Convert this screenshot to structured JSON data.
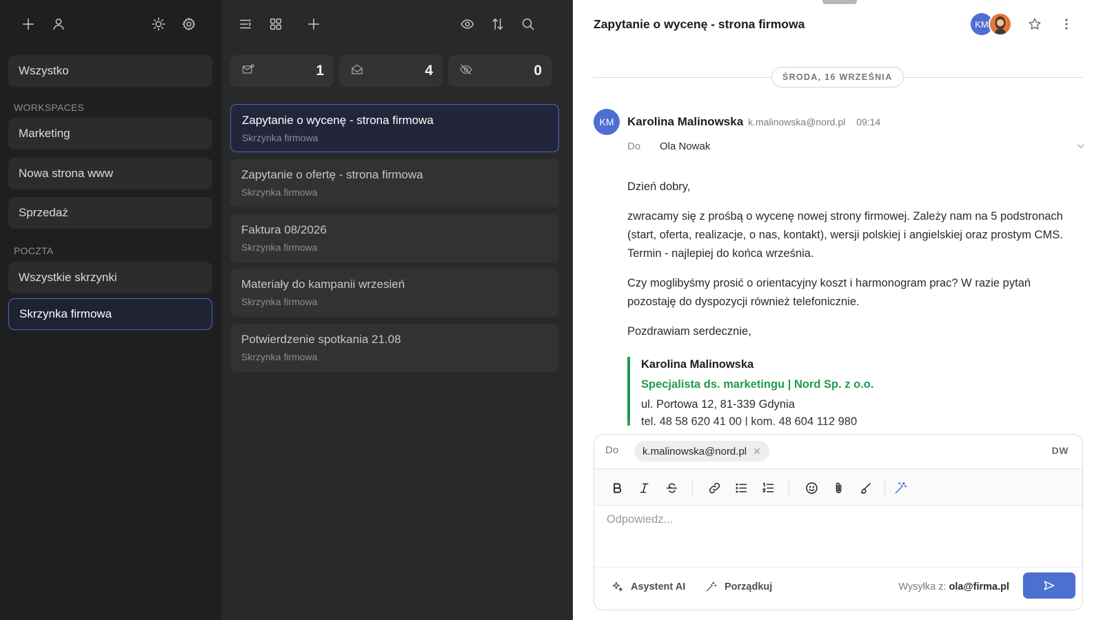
{
  "sidebar": {
    "top_icons": [
      "plus-icon",
      "user-icon",
      "sun-icon",
      "gear-icon"
    ],
    "all_label": "Wszystko",
    "workspaces_heading": "WORKSPACES",
    "workspaces": [
      {
        "label": "Marketing"
      },
      {
        "label": "Nowa strona www"
      },
      {
        "label": "Sprzedaż"
      }
    ],
    "mail_heading": "POCZTA",
    "mailboxes": [
      {
        "label": "Wszystkie skrzynki",
        "active": false
      },
      {
        "label": "Skrzynka firmowa",
        "active": true
      }
    ]
  },
  "list": {
    "top_icons": [
      "list-indent-icon",
      "grid-icon",
      "plus-icon",
      "eye-icon",
      "sort-icon",
      "search-icon"
    ],
    "counters": [
      {
        "icon": "unread-mail-icon",
        "value": "1"
      },
      {
        "icon": "open-mail-icon",
        "value": "4"
      },
      {
        "icon": "hidden-icon",
        "value": "0"
      }
    ],
    "items": [
      {
        "subject": "Zapytanie o wycenę - strona firmowa",
        "mailbox": "Skrzynka firmowa",
        "active": true
      },
      {
        "subject": "Zapytanie o ofertę - strona firmowa",
        "mailbox": "Skrzynka firmowa",
        "active": false
      },
      {
        "subject": "Faktura 08/2026",
        "mailbox": "Skrzynka firmowa",
        "active": false
      },
      {
        "subject": "Materiały do kampanii wrzesień",
        "mailbox": "Skrzynka firmowa",
        "active": false
      },
      {
        "subject": "Potwierdzenie spotkania 21.08",
        "mailbox": "Skrzynka firmowa",
        "active": false
      }
    ]
  },
  "reader": {
    "title": "Zapytanie o wycenę - strona firmowa",
    "participant_initials": "KM",
    "date_label": "ŚRODA, 16 WRZEŚNIA",
    "sender": {
      "initials": "KM",
      "name": "Karolina Malinowska",
      "email": "k.malinowska@nord.pl",
      "time": "09:14"
    },
    "to_label": "Do",
    "to_value": "Ola Nowak",
    "body": {
      "greeting": "Dzień dobry,",
      "p1": "zwracamy się z prośbą o wycenę nowej strony firmowej. Zależy nam na 5 podstronach (start, oferta, realizacje, o nas, kontakt), wersji polskiej i angielskiej oraz prostym CMS. Termin - najlepiej do końca września.",
      "p2": "Czy moglibyśmy prosić o orientacyjny koszt i harmonogram prac? W razie pytań pozostaję do dyspozycji również telefonicznie.",
      "closing": "Pozdrawiam serdecznie,"
    },
    "signature": {
      "name": "Karolina Malinowska",
      "role": "Specjalista ds. marketingu | Nord Sp. z o.o.",
      "address": "ul. Portowa 12, 81-339 Gdynia",
      "phone": "tel. 48 58 620 41 00 | kom. 48 604 112 980"
    }
  },
  "composer": {
    "to_label": "Do",
    "recipient": "k.malinowska@nord.pl",
    "sender_initials": "DW",
    "toolbar_icons": [
      "bold-icon",
      "italic-icon",
      "strikethrough-icon",
      "link-icon",
      "bullet-list-icon",
      "numbered-list-icon",
      "emoji-icon",
      "attachment-icon",
      "brush-icon",
      "magic-wand-icon"
    ],
    "placeholder": "Odpowiedz...",
    "ai_label": "Asystent AI",
    "tidy_label": "Porządkuj",
    "from_label": "Wysyłka z:",
    "from_value": "ola@firma.pl"
  },
  "colors": {
    "accent": "#4c6fd0",
    "active_border": "#4f68c8",
    "signature_green": "#1f9a4d",
    "sidebar_bg": "#1f1f21",
    "list_bg": "#29292c"
  }
}
